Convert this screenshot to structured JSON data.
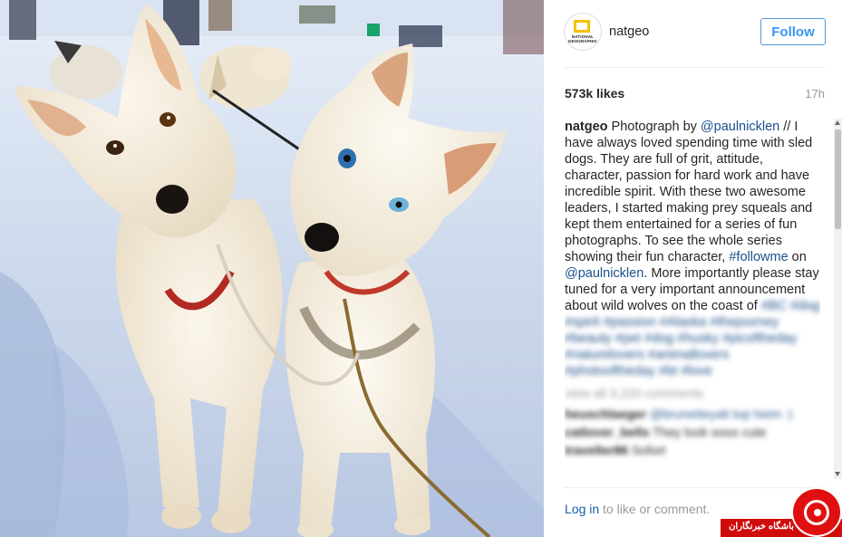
{
  "post": {
    "username": "natgeo",
    "follow_label": "Follow",
    "likes": "573k likes",
    "time": "17h",
    "avatar_text": "NATIONAL GEOGRAPHIC"
  },
  "caption": {
    "username": "natgeo",
    "p1": " Photograph by ",
    "mention1": "@paulnicklen",
    "p2": " // I have always loved spending time with sled dogs. They are full of grit, attitude, character, passion for hard work and have incredible spirit. With these two awesome leaders, I started making prey squeals and kept them entertained for a series of fun photographs. To see the whole series showing their fun character, ",
    "hashtag1": "#followme",
    "p3": " on ",
    "mention2": "@paulnicklen",
    "p4": ". More importantly please stay tuned for a very important announcement about wild wolves on the coast of ",
    "hashtag2": "#BC",
    "hashtags_rest": "#dog #spirit #passion #Alaska #thejourney #beauty #pet #dog #husky #picoftheday #naturelovers #animallovers #photooftheday #bt #love"
  },
  "comments": {
    "view_all": "view all 3,220 comments",
    "items": [
      {
        "user": "heuschlaeger",
        "text": "@brunetteyalt top heim :)"
      },
      {
        "user": "catlover_bells",
        "text": "They look sooo cute"
      },
      {
        "user": "traveller86",
        "text": "Sofort"
      }
    ]
  },
  "footer": {
    "login_link": "Log in",
    "login_rest": " to like or comment."
  },
  "watermark": {
    "text": "باشگاه خبرنگاران"
  },
  "colors": {
    "accent": "#3897f0",
    "link": "#1b4f8a",
    "watermark_red": "#e01010"
  }
}
